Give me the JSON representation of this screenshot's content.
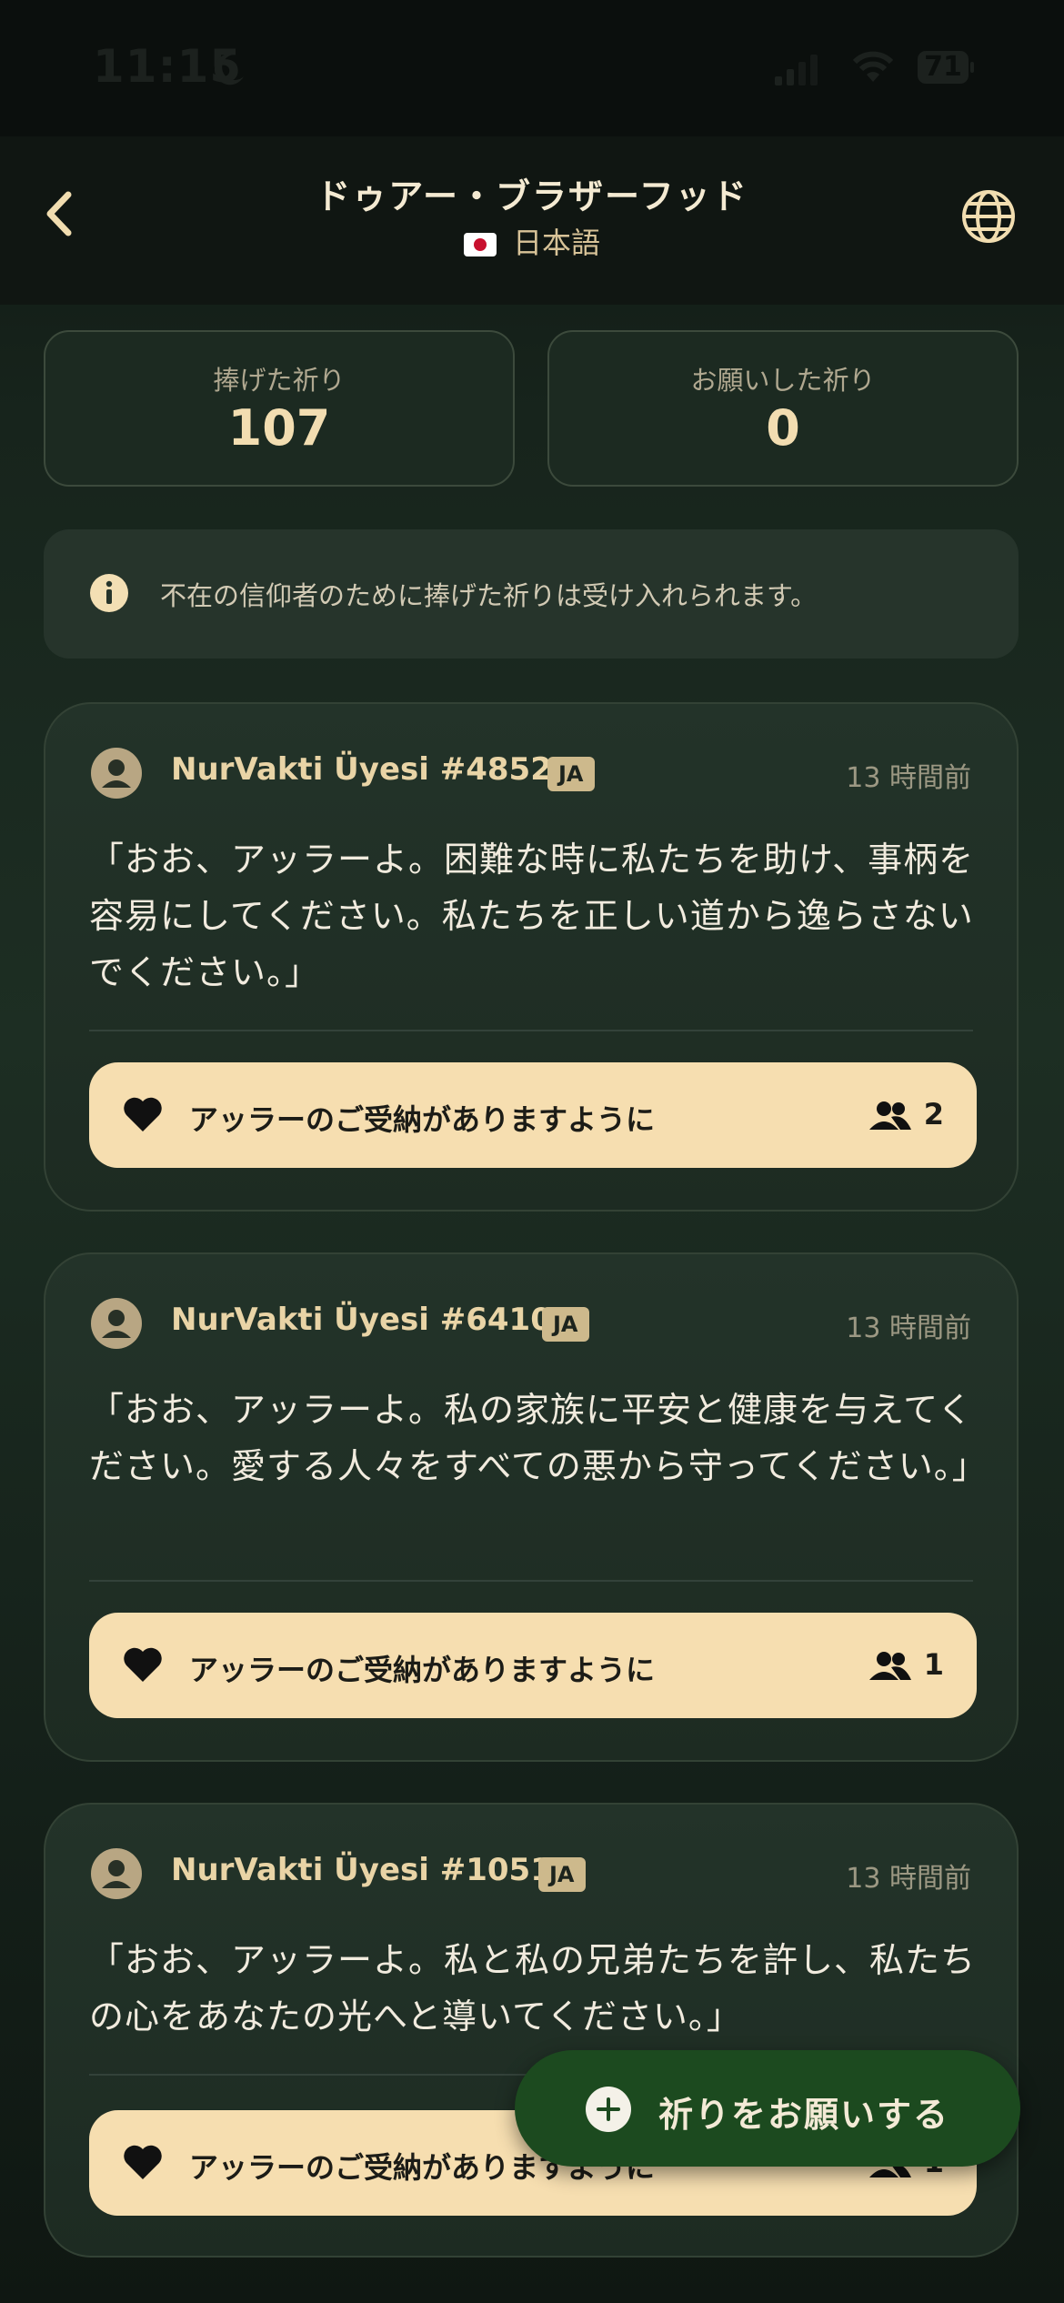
{
  "status_bar": {
    "time": "11:15",
    "battery": "71"
  },
  "header": {
    "title": "ドゥアー・ブラザーフッド",
    "language": "日本語"
  },
  "stats": {
    "offered_label": "捧げた祈り",
    "offered_value": "107",
    "requested_label": "お願いした祈り",
    "requested_value": "0"
  },
  "info": {
    "text": "不在の信仰者のために捧げた祈りは受け入れられます。"
  },
  "prayers": [
    {
      "author": "NurVakti Üyesi #4852",
      "lang": "JA",
      "time": "13 時間前",
      "text": "「おお、アッラーよ。困難な時に私たちを助け、事柄を容易にしてください。私たちを正しい道から逸らさないでください。」",
      "amen_label": "アッラーのご受納がありますように",
      "count": "2"
    },
    {
      "author": "NurVakti Üyesi #6410",
      "lang": "JA",
      "time": "13 時間前",
      "text": "「おお、アッラーよ。私の家族に平安と健康を与えてください。愛する人々をすべての悪から守ってください。」",
      "amen_label": "アッラーのご受納がありますように",
      "count": "1"
    },
    {
      "author": "NurVakti Üyesi #1051",
      "lang": "JA",
      "time": "13 時間前",
      "text": "「おお、アッラーよ。私と私の兄弟たちを許し、私たちの心をあなたの光へと導いてください。」",
      "amen_label": "アッラーのご受納がありますように",
      "count": "1"
    }
  ],
  "fab": {
    "label": "祈りをお願いする"
  },
  "colors": {
    "accent_cream": "#f6deb0",
    "fab_green": "#1c4a1f",
    "background": "#1a2920"
  }
}
